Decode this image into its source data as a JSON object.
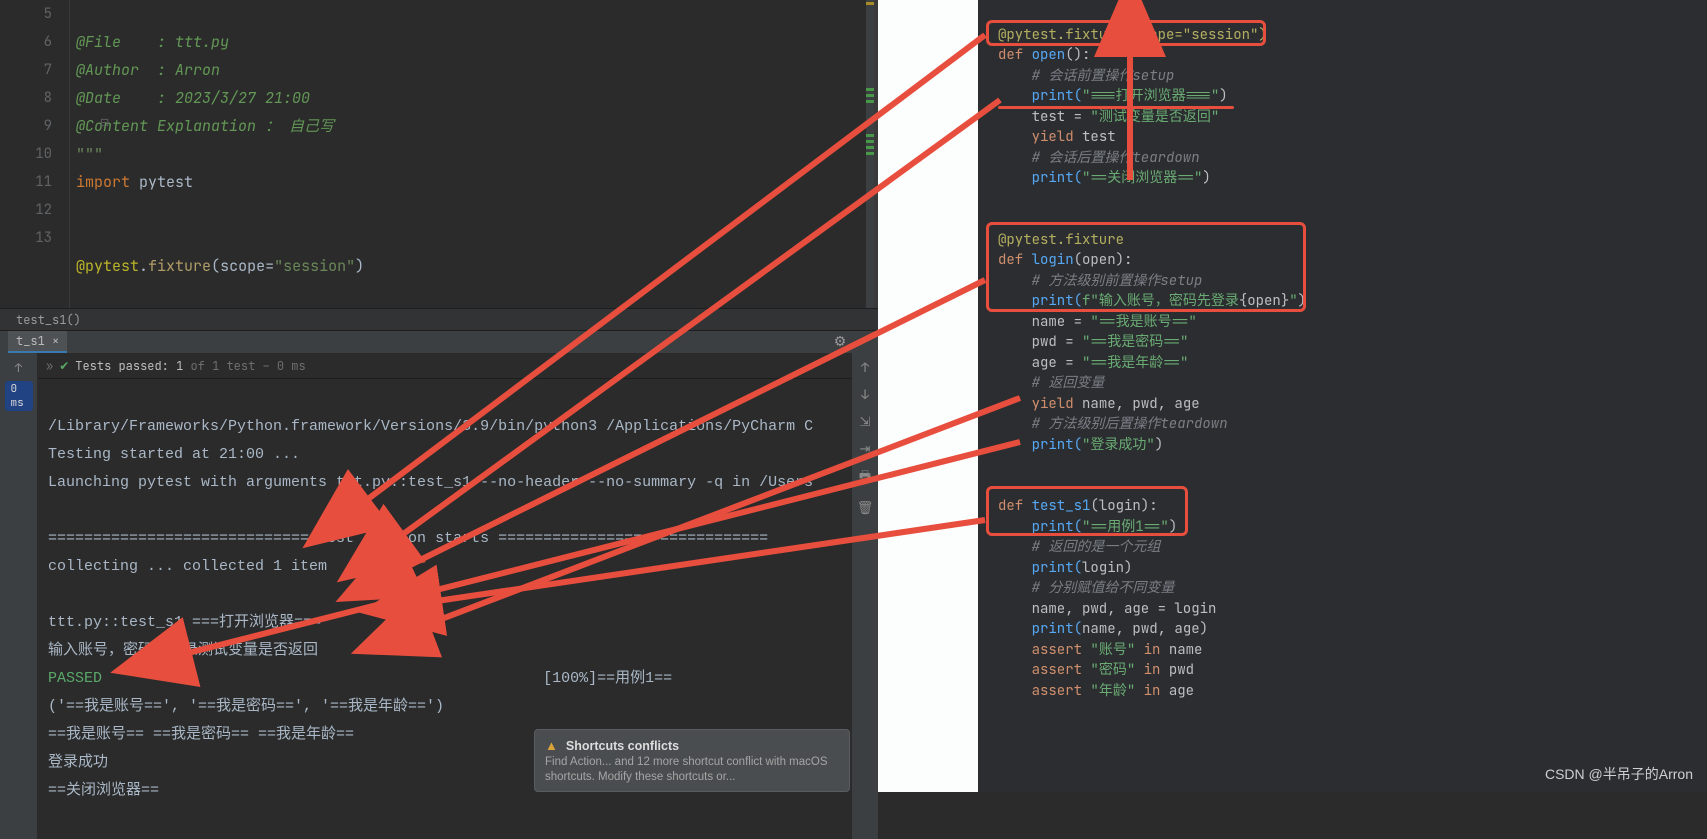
{
  "editor": {
    "gutter": [
      "5",
      "6",
      "7",
      "8",
      "9",
      "10",
      "11",
      "12",
      "13"
    ],
    "lines": {
      "l5": {
        "prefix": "@File    : ",
        "val": "ttt.py"
      },
      "l6": {
        "prefix": "@Author  : ",
        "val": "Arron"
      },
      "l7": {
        "prefix": "@Date    : ",
        "val": "2023/3/27 21:00"
      },
      "l8": {
        "prefix": "@Content Explanation ： ",
        "val": "自己写"
      },
      "l9": "\"\"\"",
      "l10_import": "import",
      "l10_mod": " pytest",
      "l13_dec": "@pytest",
      "l13_dot": ".",
      "l13_fn": "fixture",
      "l13_open": "(",
      "l13_arg": "scope",
      "l13_eq": "=",
      "l13_str": "\"session\"",
      "l13_close": ")"
    },
    "breadcrumb": "test_s1()"
  },
  "run": {
    "tab": "t_s1 ×",
    "status_chev": "»",
    "status_prefix": "Tests passed: 1",
    "status_suffix": " of 1 test – 0 ms",
    "time_pill": "0 ms"
  },
  "console": {
    "l1": "/Library/Frameworks/Python.framework/Versions/3.9/bin/python3 /Applications/PyCharm C",
    "l2": "Testing started at 21:00 ...",
    "l3": "Launching pytest with arguments ttt.py::test_s1 --no-header --no-summary -q in /Users",
    "l4": "",
    "l5": "============================= test session starts ==============================",
    "l6": "collecting ... collected 1 item",
    "l7": "",
    "l8": "ttt.py::test_s1 ===打开浏览器===",
    "l9": "输入账号，密码先登录测试变量是否返回",
    "l10a": "PASSED",
    "l10b": "                                                 [100%]",
    "l10c": "==用例1==",
    "l11": "('==我是账号==', '==我是密码==', '==我是年龄==')",
    "l12": "==我是账号== ==我是密码== ==我是年龄==",
    "l13": "登录成功",
    "l14": "==关闭浏览器=="
  },
  "popup": {
    "title": "Shortcuts conflicts",
    "body": "Find Action... and 12 more shortcut conflict with macOS shortcuts. Modify these shortcuts or..."
  },
  "right": {
    "b1": {
      "dec": "@pytest.fixture(scope=\"session\")",
      "def": "def ",
      "fn": "open",
      "par": "():",
      "c1": "# 会话前置操作setup",
      "p1a": "print(",
      "p1s": "\"===打开浏览器===\"",
      "p1b": ")",
      "tassign": "test = ",
      "tstr": "\"测试变量是否返回\"",
      "yield": "yield ",
      "yvar": "test",
      "c2": "# 会话后置操作teardown",
      "p2a": "print(",
      "p2s": "\"==关闭浏览器==\"",
      "p2b": ")"
    },
    "b2": {
      "dec": "@pytest.fixture",
      "def": "def ",
      "fn": "login",
      "par": "(open):",
      "c1": "# 方法级别前置操作setup",
      "p1a": "print(",
      "p1f": "f\"输入账号，密码先登录",
      "p1o": "{",
      "p1v": "open",
      "p1c": "}",
      "p1e": "\"",
      "p1b": ")",
      "nassign": "name = ",
      "nstr": "\"==我是账号==\"",
      "passign": "pwd = ",
      "pstr": "\"==我是密码==\"",
      "aassign": "age = ",
      "astr": "\"==我是年龄==\"",
      "c2": "# 返回变量",
      "yield": "yield ",
      "yvars": "name, pwd, age",
      "c3": "# 方法级别后置操作teardown",
      "p2a": "print(",
      "p2s": "\"登录成功\"",
      "p2b": ")"
    },
    "b3": {
      "def": "def ",
      "fn": "test_s1",
      "par": "(login):",
      "p1a": "print(",
      "p1s": "\"==用例1==\"",
      "p1b": ")",
      "c1": "# 返回的是一个元组",
      "p2a": "print(",
      "p2v": "login",
      "p2b": ")",
      "c2": "# 分别赋值给不同变量",
      "unpack": "name, pwd, age = login",
      "p3a": "print(",
      "p3v": "name, pwd, age",
      "p3b": ")",
      "a1a": "assert ",
      "a1s": "\"账号\"",
      "a1b": " in ",
      "a1v": "name",
      "a2a": "assert ",
      "a2s": "\"密码\"",
      "a2b": " in ",
      "a2v": "pwd",
      "a3a": "assert ",
      "a3s": "\"年龄\"",
      "a3b": " in ",
      "a3v": "age"
    }
  },
  "watermark": "CSDN @半吊子的Arron"
}
